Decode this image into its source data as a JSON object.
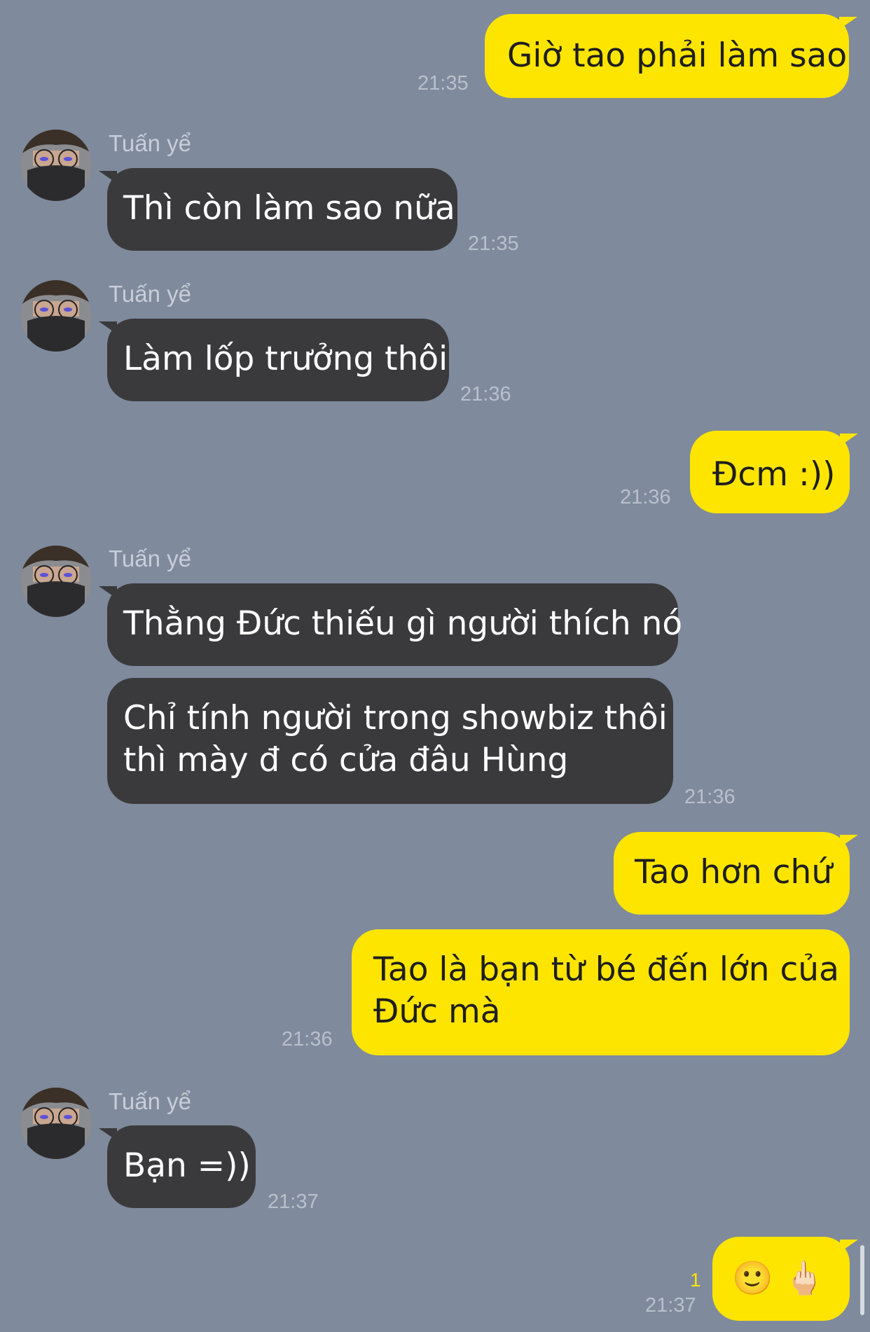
{
  "contact": {
    "name": "Tuấn yể"
  },
  "messages": [
    {
      "text": "Giờ tao phải làm sao",
      "time": "21:35"
    },
    {
      "text": "Thì còn làm sao nữa",
      "time": "21:35"
    },
    {
      "text": "Làm lốp trưởng thôi",
      "time": "21:36"
    },
    {
      "text": "Đcm :))",
      "time": "21:36"
    },
    {
      "text": "Thằng Đức thiếu gì người thích nó"
    },
    {
      "line1": "Chỉ tính người trong showbiz thôi",
      "line2": "thì mày đ có cửa đâu Hùng",
      "time": "21:36"
    },
    {
      "text": "Tao hơn chứ"
    },
    {
      "line1": "Tao là bạn từ bé đến lớn của",
      "line2": "Đức mà",
      "time": "21:36"
    },
    {
      "text": "Bạn =))",
      "time": "21:37"
    },
    {
      "text": "🙂 🖕🏻",
      "time": "21:37",
      "unread": "1"
    }
  ],
  "colors": {
    "background": "#7f8a9c",
    "outgoing": "#fee500",
    "incoming": "#3a3a3c"
  }
}
